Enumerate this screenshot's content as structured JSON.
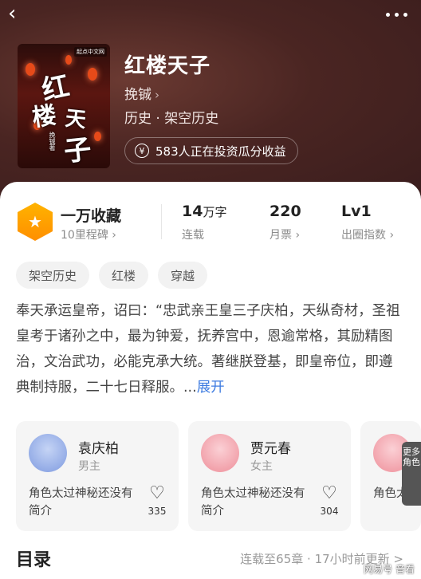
{
  "header": {
    "back_icon": "chevron-left-icon",
    "more_icon": "more-dots-icon"
  },
  "book": {
    "title": "红楼天子",
    "author": "挽铖",
    "genre": "历史 · 架空历史",
    "invest_text": "583人正在投资瓜分收益",
    "cover": {
      "glyph1": "红",
      "glyph2": "楼",
      "glyph3": "天",
      "glyph4": "子",
      "author_small": "挽铖著",
      "publisher_badge": "起点中文网"
    }
  },
  "stats": {
    "collection_main": "一万收藏",
    "collection_sub": "10里程碑",
    "words_value": "14",
    "words_unit": "万字",
    "words_sub": "连载",
    "tickets_value": "220",
    "tickets_sub": "月票",
    "level_value": "Lv1",
    "level_sub": "出圈指数"
  },
  "tags": [
    "架空历史",
    "红楼",
    "穿越"
  ],
  "synopsis": {
    "text": "奉天承运皇帝，诏曰：“忠武亲王皇三子庆柏，天纵奇材，圣祖皇考于诸孙之中，最为钟爱，抚养宫中，恩逾常格，其励精图治，文治武功，必能克承大统。著继朕登基，即皇帝位，即遵典制持服，二十七日释服。...",
    "expand": "展开"
  },
  "characters": [
    {
      "name": "袁庆柏",
      "role": "男主",
      "desc": "角色太过神秘还没有简介",
      "likes": "335",
      "color": "#8fa8e8"
    },
    {
      "name": "贾元春",
      "role": "女主",
      "desc": "角色太过神秘还没有简介",
      "likes": "304",
      "color": "#f0a0a8"
    },
    {
      "name": "",
      "role": "",
      "desc": "角色太过神秘还没有简介",
      "likes": "",
      "color": "#f0a0a8"
    }
  ],
  "more_roles": "更多角色",
  "toc": {
    "title": "目录",
    "status": "连载至65章 · 17小时前更新 >"
  },
  "watermark": "网易号 音看"
}
